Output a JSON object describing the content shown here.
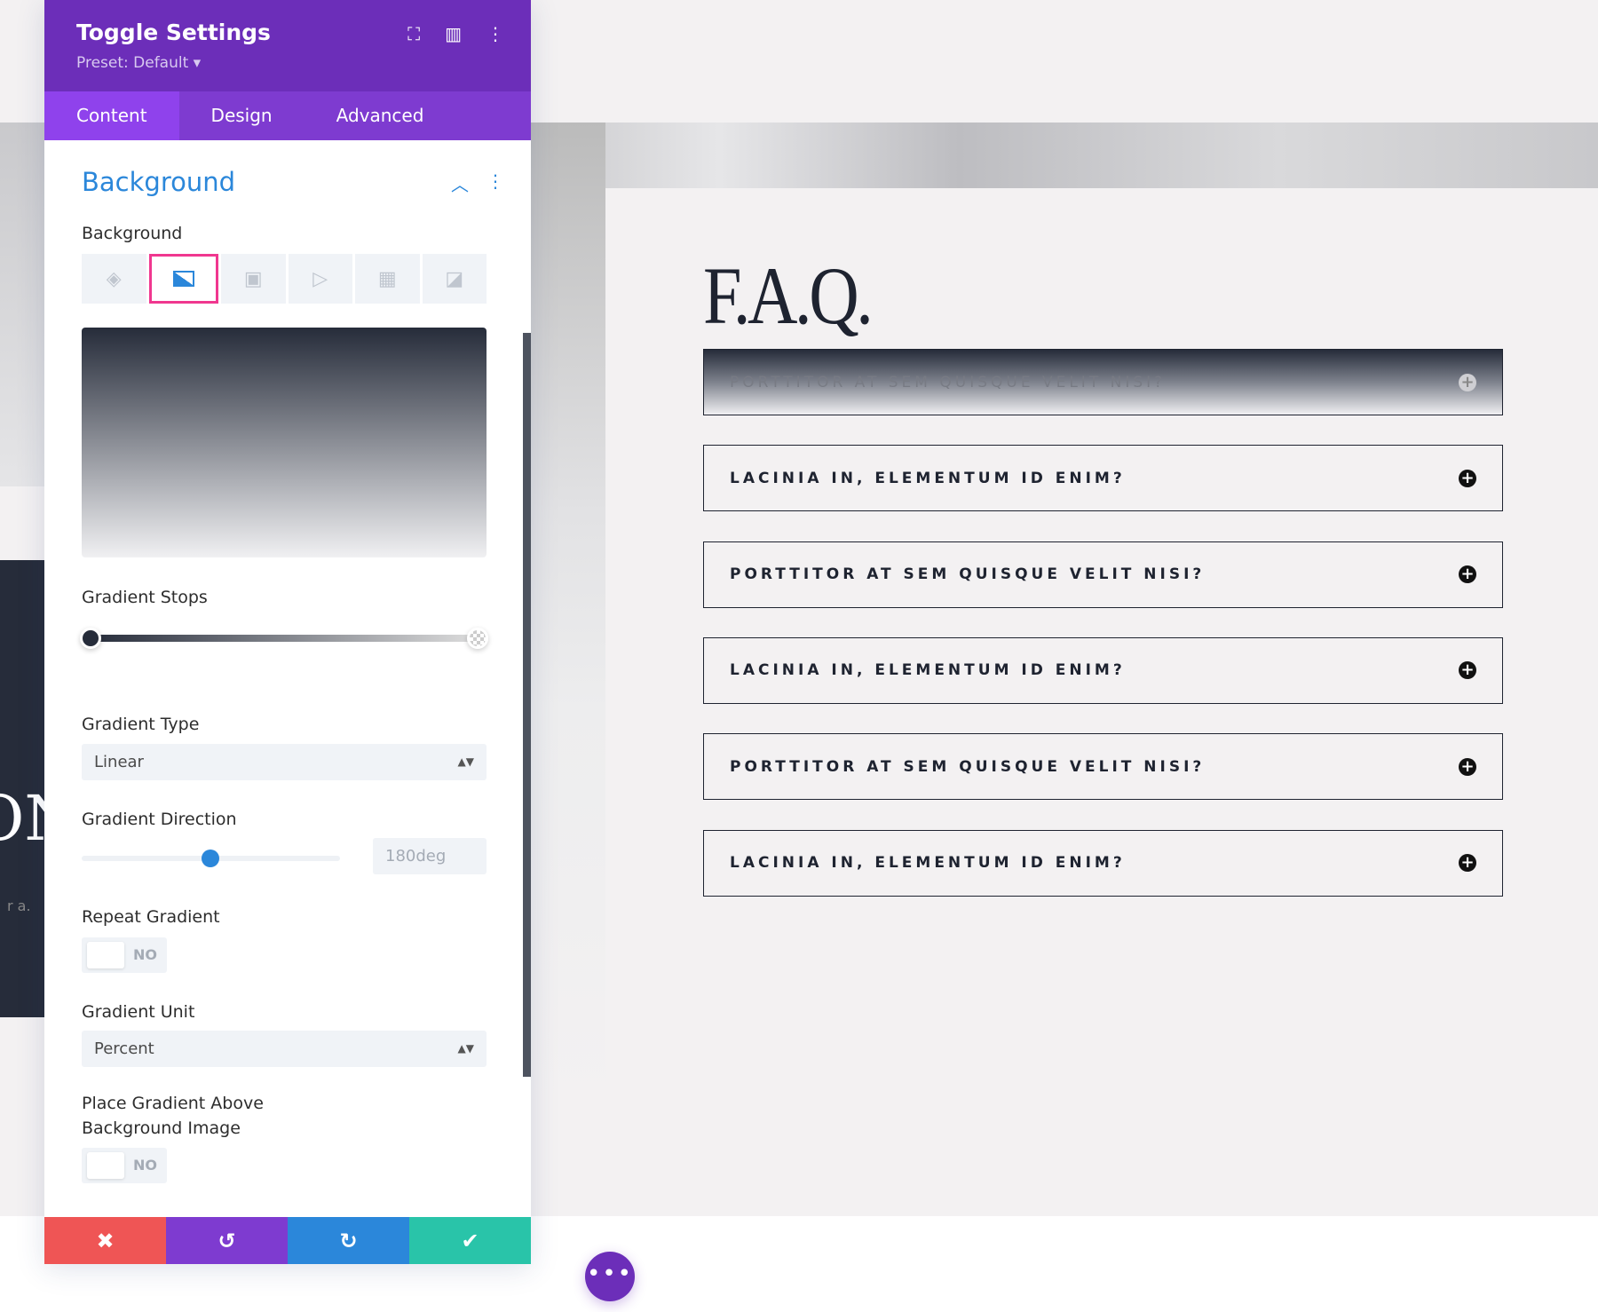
{
  "panel": {
    "title": "Toggle Settings",
    "preset": "Preset: Default ▾",
    "tabs": [
      "Content",
      "Design",
      "Advanced"
    ],
    "section_title": "Background",
    "background_label": "Background",
    "bg_type_icons": [
      "paint-bucket-icon",
      "gradient-icon",
      "image-icon",
      "video-icon",
      "pattern-icon",
      "mask-icon"
    ],
    "selected_bg_type": "gradient",
    "gradient_stops_label": "Gradient Stops",
    "gradient_colors": [
      "#262c3a",
      "#ffffff00"
    ],
    "gradient_type_label": "Gradient Type",
    "gradient_type": "Linear",
    "gradient_direction_label": "Gradient Direction",
    "gradient_direction": "180deg",
    "gradient_direction_value": 180,
    "repeat_gradient_label": "Repeat Gradient",
    "repeat_gradient": "NO",
    "gradient_unit_label": "Gradient Unit",
    "gradient_unit": "Percent",
    "place_above_label_1": "Place Gradient Above",
    "place_above_label_2": "Background Image",
    "place_above": "NO"
  },
  "colors": {
    "header": "#6c2eb9",
    "accent": "#2b87da",
    "cancel": "#ef5555",
    "undo": "#7e3bd0",
    "redo": "#2b87da",
    "save": "#29c4a9",
    "highlight": "#f0378f"
  },
  "page": {
    "faq_title": "F.A.Q.",
    "left_fragment": "ON",
    "left_small": "r a.",
    "toggles": [
      "PORTTITOR AT SEM QUISQUE VELIT NISI?",
      "LACINIA IN, ELEMENTUM ID ENIM?",
      "PORTTITOR AT SEM QUISQUE VELIT NISI?",
      "LACINIA IN, ELEMENTUM ID ENIM?",
      "PORTTITOR AT SEM QUISQUE VELIT NISI?",
      "LACINIA IN, ELEMENTUM ID ENIM?"
    ]
  }
}
